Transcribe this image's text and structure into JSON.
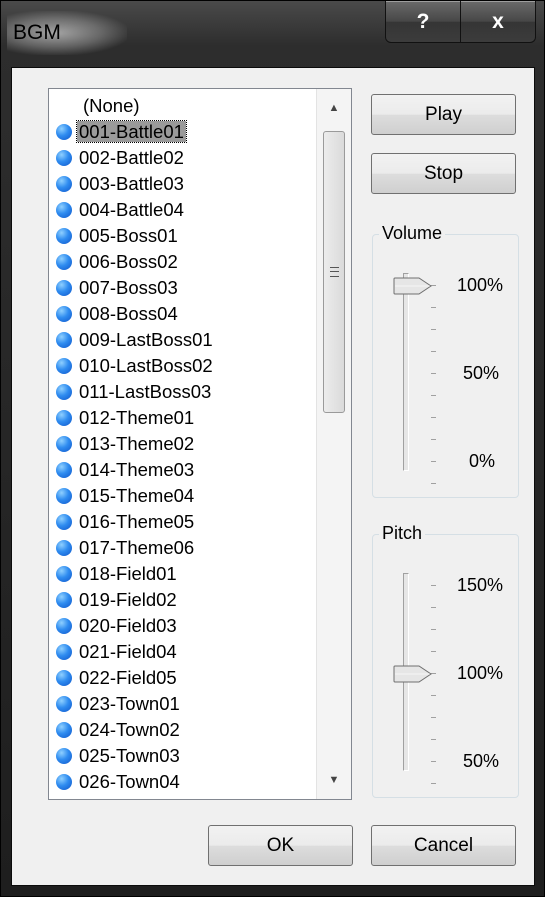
{
  "window": {
    "title": "BGM",
    "help_label": "?",
    "close_label": "x"
  },
  "list": {
    "items": [
      {
        "label": "(None)",
        "icon": "none",
        "selected": false
      },
      {
        "label": "001-Battle01",
        "icon": "audio-dot-icon",
        "selected": true
      },
      {
        "label": "002-Battle02",
        "icon": "audio-dot-icon",
        "selected": false
      },
      {
        "label": "003-Battle03",
        "icon": "audio-dot-icon",
        "selected": false
      },
      {
        "label": "004-Battle04",
        "icon": "audio-dot-icon",
        "selected": false
      },
      {
        "label": "005-Boss01",
        "icon": "audio-dot-icon",
        "selected": false
      },
      {
        "label": "006-Boss02",
        "icon": "audio-dot-icon",
        "selected": false
      },
      {
        "label": "007-Boss03",
        "icon": "audio-dot-icon",
        "selected": false
      },
      {
        "label": "008-Boss04",
        "icon": "audio-dot-icon",
        "selected": false
      },
      {
        "label": "009-LastBoss01",
        "icon": "audio-dot-icon",
        "selected": false
      },
      {
        "label": "010-LastBoss02",
        "icon": "audio-dot-icon",
        "selected": false
      },
      {
        "label": "011-LastBoss03",
        "icon": "audio-dot-icon",
        "selected": false
      },
      {
        "label": "012-Theme01",
        "icon": "audio-dot-icon",
        "selected": false
      },
      {
        "label": "013-Theme02",
        "icon": "audio-dot-icon",
        "selected": false
      },
      {
        "label": "014-Theme03",
        "icon": "audio-dot-icon",
        "selected": false
      },
      {
        "label": "015-Theme04",
        "icon": "audio-dot-icon",
        "selected": false
      },
      {
        "label": "016-Theme05",
        "icon": "audio-dot-icon",
        "selected": false
      },
      {
        "label": "017-Theme06",
        "icon": "audio-dot-icon",
        "selected": false
      },
      {
        "label": "018-Field01",
        "icon": "audio-dot-icon",
        "selected": false
      },
      {
        "label": "019-Field02",
        "icon": "audio-dot-icon",
        "selected": false
      },
      {
        "label": "020-Field03",
        "icon": "audio-dot-icon",
        "selected": false
      },
      {
        "label": "021-Field04",
        "icon": "audio-dot-icon",
        "selected": false
      },
      {
        "label": "022-Field05",
        "icon": "audio-dot-icon",
        "selected": false
      },
      {
        "label": "023-Town01",
        "icon": "audio-dot-icon",
        "selected": false
      },
      {
        "label": "024-Town02",
        "icon": "audio-dot-icon",
        "selected": false
      },
      {
        "label": "025-Town03",
        "icon": "audio-dot-icon",
        "selected": false
      },
      {
        "label": "026-Town04",
        "icon": "audio-dot-icon",
        "selected": false
      }
    ]
  },
  "buttons": {
    "play": "Play",
    "stop": "Stop",
    "ok": "OK",
    "cancel": "Cancel"
  },
  "volume": {
    "legend": "Volume",
    "label_top": "100%",
    "label_mid": "50%",
    "label_bottom": "0%",
    "value_percent": 100
  },
  "pitch": {
    "legend": "Pitch",
    "label_top": "150%",
    "label_mid": "100%",
    "label_bottom": "50%",
    "value_percent": 100
  },
  "colors": {
    "selection": "#9a9a9a",
    "dot": "#2f8cf0",
    "client_bg": "#f0f0f0"
  }
}
